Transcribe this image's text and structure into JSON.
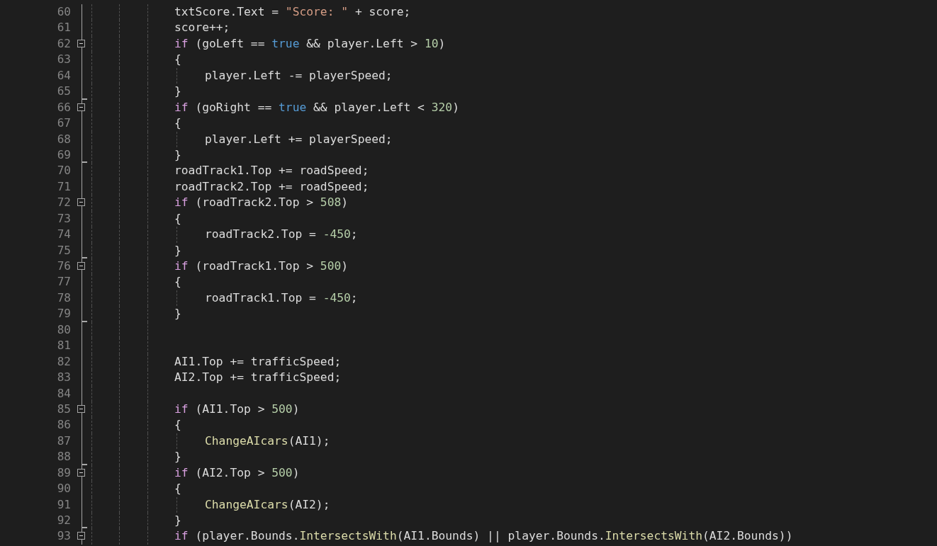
{
  "editor": {
    "lines": [
      {
        "number": "60",
        "foldable": false,
        "block_end": false,
        "indented": false,
        "tokens": [
          {
            "kind": "plain",
            "text": "txtScore.Text = "
          },
          {
            "kind": "string",
            "text": "\"Score: \""
          },
          {
            "kind": "plain",
            "text": " + score;"
          }
        ]
      },
      {
        "number": "61",
        "foldable": false,
        "block_end": false,
        "indented": false,
        "tokens": [
          {
            "kind": "plain",
            "text": "score++;"
          }
        ]
      },
      {
        "number": "62",
        "foldable": true,
        "block_end": false,
        "indented": false,
        "tokens": [
          {
            "kind": "keyword",
            "text": "if"
          },
          {
            "kind": "plain",
            "text": " (goLeft == "
          },
          {
            "kind": "literal",
            "text": "true"
          },
          {
            "kind": "plain",
            "text": " && player.Left > "
          },
          {
            "kind": "number",
            "text": "10"
          },
          {
            "kind": "plain",
            "text": ")"
          }
        ]
      },
      {
        "number": "63",
        "foldable": false,
        "block_end": false,
        "indented": false,
        "tokens": [
          {
            "kind": "plain",
            "text": "{"
          }
        ]
      },
      {
        "number": "64",
        "foldable": false,
        "block_end": false,
        "indented": true,
        "tokens": [
          {
            "kind": "plain",
            "text": "player.Left -= playerSpeed;"
          }
        ]
      },
      {
        "number": "65",
        "foldable": false,
        "block_end": true,
        "indented": false,
        "tokens": [
          {
            "kind": "plain",
            "text": "}"
          }
        ]
      },
      {
        "number": "66",
        "foldable": true,
        "block_end": false,
        "indented": false,
        "tokens": [
          {
            "kind": "keyword",
            "text": "if"
          },
          {
            "kind": "plain",
            "text": " (goRight == "
          },
          {
            "kind": "literal",
            "text": "true"
          },
          {
            "kind": "plain",
            "text": " && player.Left < "
          },
          {
            "kind": "number",
            "text": "320"
          },
          {
            "kind": "plain",
            "text": ")"
          }
        ]
      },
      {
        "number": "67",
        "foldable": false,
        "block_end": false,
        "indented": false,
        "tokens": [
          {
            "kind": "plain",
            "text": "{"
          }
        ]
      },
      {
        "number": "68",
        "foldable": false,
        "block_end": false,
        "indented": true,
        "tokens": [
          {
            "kind": "plain",
            "text": "player.Left += playerSpeed;"
          }
        ]
      },
      {
        "number": "69",
        "foldable": false,
        "block_end": true,
        "indented": false,
        "tokens": [
          {
            "kind": "plain",
            "text": "}"
          }
        ]
      },
      {
        "number": "70",
        "foldable": false,
        "block_end": false,
        "indented": false,
        "tokens": [
          {
            "kind": "plain",
            "text": "roadTrack1.Top += roadSpeed;"
          }
        ]
      },
      {
        "number": "71",
        "foldable": false,
        "block_end": false,
        "indented": false,
        "tokens": [
          {
            "kind": "plain",
            "text": "roadTrack2.Top += roadSpeed;"
          }
        ]
      },
      {
        "number": "72",
        "foldable": true,
        "block_end": false,
        "indented": false,
        "tokens": [
          {
            "kind": "keyword",
            "text": "if"
          },
          {
            "kind": "plain",
            "text": " (roadTrack2.Top > "
          },
          {
            "kind": "number",
            "text": "508"
          },
          {
            "kind": "plain",
            "text": ")"
          }
        ]
      },
      {
        "number": "73",
        "foldable": false,
        "block_end": false,
        "indented": false,
        "tokens": [
          {
            "kind": "plain",
            "text": "{"
          }
        ]
      },
      {
        "number": "74",
        "foldable": false,
        "block_end": false,
        "indented": true,
        "tokens": [
          {
            "kind": "plain",
            "text": "roadTrack2.Top = "
          },
          {
            "kind": "number",
            "text": "-450"
          },
          {
            "kind": "plain",
            "text": ";"
          }
        ]
      },
      {
        "number": "75",
        "foldable": false,
        "block_end": true,
        "indented": false,
        "tokens": [
          {
            "kind": "plain",
            "text": "}"
          }
        ]
      },
      {
        "number": "76",
        "foldable": true,
        "block_end": false,
        "indented": false,
        "tokens": [
          {
            "kind": "keyword",
            "text": "if"
          },
          {
            "kind": "plain",
            "text": " (roadTrack1.Top > "
          },
          {
            "kind": "number",
            "text": "500"
          },
          {
            "kind": "plain",
            "text": ")"
          }
        ]
      },
      {
        "number": "77",
        "foldable": false,
        "block_end": false,
        "indented": false,
        "tokens": [
          {
            "kind": "plain",
            "text": "{"
          }
        ]
      },
      {
        "number": "78",
        "foldable": false,
        "block_end": false,
        "indented": true,
        "tokens": [
          {
            "kind": "plain",
            "text": "roadTrack1.Top = "
          },
          {
            "kind": "number",
            "text": "-450"
          },
          {
            "kind": "plain",
            "text": ";"
          }
        ]
      },
      {
        "number": "79",
        "foldable": false,
        "block_end": true,
        "indented": false,
        "tokens": [
          {
            "kind": "plain",
            "text": "}"
          }
        ]
      },
      {
        "number": "80",
        "foldable": false,
        "block_end": false,
        "indented": false
      },
      {
        "number": "81",
        "foldable": false,
        "block_end": false,
        "indented": false
      },
      {
        "number": "82",
        "foldable": false,
        "block_end": false,
        "indented": false,
        "tokens": [
          {
            "kind": "plain",
            "text": "AI1.Top += trafficSpeed;"
          }
        ]
      },
      {
        "number": "83",
        "foldable": false,
        "block_end": false,
        "indented": false,
        "tokens": [
          {
            "kind": "plain",
            "text": "AI2.Top += trafficSpeed;"
          }
        ]
      },
      {
        "number": "84",
        "foldable": false,
        "block_end": false,
        "indented": false
      },
      {
        "number": "85",
        "foldable": true,
        "block_end": false,
        "indented": false,
        "tokens": [
          {
            "kind": "keyword",
            "text": "if"
          },
          {
            "kind": "plain",
            "text": " (AI1.Top > "
          },
          {
            "kind": "number",
            "text": "500"
          },
          {
            "kind": "plain",
            "text": ")"
          }
        ]
      },
      {
        "number": "86",
        "foldable": false,
        "block_end": false,
        "indented": false,
        "tokens": [
          {
            "kind": "plain",
            "text": "{"
          }
        ]
      },
      {
        "number": "87",
        "foldable": false,
        "block_end": false,
        "indented": true,
        "tokens": [
          {
            "kind": "method",
            "text": "ChangeAIcars"
          },
          {
            "kind": "plain",
            "text": "(AI1);"
          }
        ]
      },
      {
        "number": "88",
        "foldable": false,
        "block_end": true,
        "indented": false,
        "tokens": [
          {
            "kind": "plain",
            "text": "}"
          }
        ]
      },
      {
        "number": "89",
        "foldable": true,
        "block_end": false,
        "indented": false,
        "tokens": [
          {
            "kind": "keyword",
            "text": "if"
          },
          {
            "kind": "plain",
            "text": " (AI2.Top > "
          },
          {
            "kind": "number",
            "text": "500"
          },
          {
            "kind": "plain",
            "text": ")"
          }
        ]
      },
      {
        "number": "90",
        "foldable": false,
        "block_end": false,
        "indented": false,
        "tokens": [
          {
            "kind": "plain",
            "text": "{"
          }
        ]
      },
      {
        "number": "91",
        "foldable": false,
        "block_end": false,
        "indented": true,
        "tokens": [
          {
            "kind": "method",
            "text": "ChangeAIcars"
          },
          {
            "kind": "plain",
            "text": "(AI2);"
          }
        ]
      },
      {
        "number": "92",
        "foldable": false,
        "block_end": true,
        "indented": false,
        "tokens": [
          {
            "kind": "plain",
            "text": "}"
          }
        ]
      },
      {
        "number": "93",
        "foldable": true,
        "block_end": false,
        "indented": false,
        "tokens": [
          {
            "kind": "keyword",
            "text": "if"
          },
          {
            "kind": "plain",
            "text": " (player.Bounds."
          },
          {
            "kind": "method",
            "text": "IntersectsWith"
          },
          {
            "kind": "plain",
            "text": "(AI1.Bounds) || player.Bounds."
          },
          {
            "kind": "method",
            "text": "IntersectsWith"
          },
          {
            "kind": "plain",
            "text": "(AI2.Bounds))"
          }
        ]
      }
    ]
  }
}
